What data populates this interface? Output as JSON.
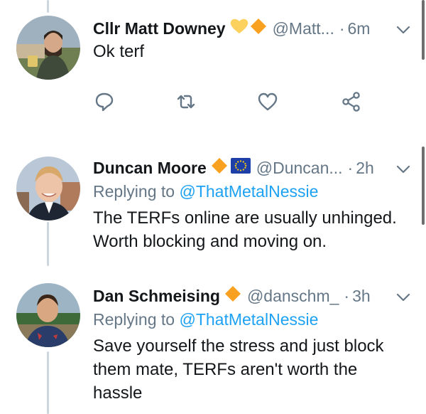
{
  "tweets": [
    {
      "name": "Cllr Matt Downey",
      "handle": "@Matt...",
      "dot": "·",
      "time": "6m",
      "text_lines": [
        "Ok terf"
      ],
      "badges": [
        "yellow-heart",
        "orange-diamond"
      ]
    },
    {
      "name": "Duncan Moore",
      "handle": "@Duncan...",
      "dot": "·",
      "time": "2h",
      "reply_prefix": "Replying to",
      "reply_to": "@ThatMetalNessie",
      "text_lines": [
        "The TERFs online are usually unhinged.",
        "Worth blocking and moving on."
      ],
      "badges": [
        "orange-diamond",
        "eu-flag"
      ]
    },
    {
      "name": "Dan Schmeising",
      "handle": "@danschm_",
      "dot": "·",
      "time": "3h",
      "reply_prefix": "Replying to",
      "reply_to": "@ThatMetalNessie",
      "text_lines": [
        "Save yourself the stress and just block",
        "them mate, TERFs aren't worth the",
        "hassle"
      ],
      "badges": [
        "orange-diamond"
      ]
    }
  ],
  "actions": [
    "reply-icon",
    "retweet-icon",
    "like-icon",
    "share-icon"
  ],
  "colors": {
    "text": "#14171a",
    "secondary": "#657786",
    "link": "#1da1f2",
    "icon": "#657786",
    "thread": "#ccd6dd"
  }
}
